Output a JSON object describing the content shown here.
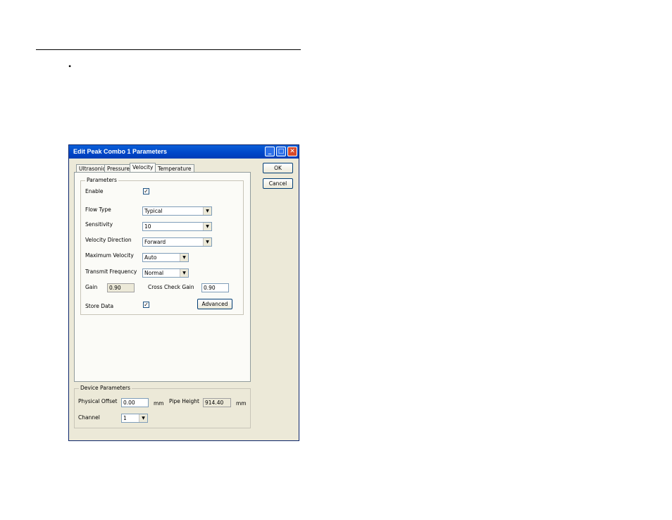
{
  "document": {
    "bullet": "•"
  },
  "window": {
    "title": "Edit Peak Combo 1 Parameters",
    "minimize": "_",
    "maximize": "□",
    "close": "✕"
  },
  "tabs": [
    {
      "label": "Ultrasonic"
    },
    {
      "label": "Pressure"
    },
    {
      "label": "Velocity"
    },
    {
      "label": "Temperature"
    }
  ],
  "buttons": {
    "ok": "OK",
    "cancel": "Cancel",
    "advanced": "Advanced"
  },
  "parameters": {
    "group_label": "Parameters",
    "enable_label": "Enable",
    "enable_checked": "✓",
    "flow_type_label": "Flow Type",
    "flow_type_value": "Typical",
    "sensitivity_label": "Sensitivity",
    "sensitivity_value": "10",
    "velocity_direction_label": "Velocity Direction",
    "velocity_direction_value": "Forward",
    "maximum_velocity_label": "Maximum Velocity",
    "maximum_velocity_value": "Auto",
    "transmit_frequency_label": "Transmit Frequency",
    "transmit_frequency_value": "Normal",
    "gain_label": "Gain",
    "gain_value": "0.90",
    "cross_check_gain_label": "Cross Check Gain",
    "cross_check_gain_value": "0.90",
    "store_data_label": "Store Data",
    "store_data_checked": "✓"
  },
  "device": {
    "group_label": "Device Parameters",
    "physical_offset_label": "Physical Offset",
    "physical_offset_value": "0.00",
    "physical_offset_unit": "mm",
    "pipe_height_label": "Pipe Height",
    "pipe_height_value": "914.40",
    "pipe_height_unit": "mm",
    "channel_label": "Channel",
    "channel_value": "1"
  },
  "icons": {
    "dropdown": "▼"
  }
}
